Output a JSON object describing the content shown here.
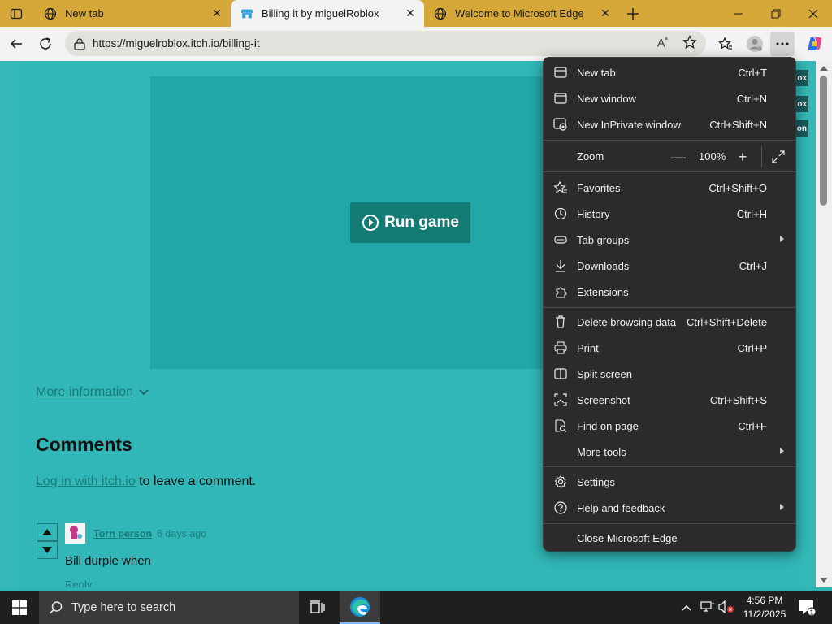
{
  "tabs": [
    {
      "label": "New tab",
      "icon": "globe-icon"
    },
    {
      "label": "Billing it by miguelRoblox",
      "icon": "itchio-icon",
      "active": true
    },
    {
      "label": "Welcome to Microsoft Edge",
      "icon": "globe-icon"
    }
  ],
  "address": {
    "url": "https://miguelroblox.itch.io/billing-it"
  },
  "page": {
    "run_label": "Run game",
    "more_info": "More information",
    "comments_heading": "Comments",
    "login_link": "Log in with itch.io",
    "login_rest": " to leave a comment.",
    "comment": {
      "author": "Torn person",
      "time": "6 days ago",
      "text": "Bill durple when",
      "reply": "Reply"
    },
    "side_pills": [
      "ox",
      "ox",
      "on"
    ]
  },
  "menu": {
    "items": [
      {
        "label": "New tab",
        "shortcut": "Ctrl+T",
        "icon": "new-tab-icon"
      },
      {
        "label": "New window",
        "shortcut": "Ctrl+N",
        "icon": "new-window-icon"
      },
      {
        "label": "New InPrivate window",
        "shortcut": "Ctrl+Shift+N",
        "icon": "inprivate-icon"
      }
    ],
    "zoom": {
      "label": "Zoom",
      "value": "100%"
    },
    "items2": [
      {
        "label": "Favorites",
        "shortcut": "Ctrl+Shift+O",
        "icon": "favorites-icon"
      },
      {
        "label": "History",
        "shortcut": "Ctrl+H",
        "icon": "history-icon"
      },
      {
        "label": "Tab groups",
        "shortcut": "",
        "icon": "tab-groups-icon",
        "submenu": true
      },
      {
        "label": "Downloads",
        "shortcut": "Ctrl+J",
        "icon": "download-icon"
      },
      {
        "label": "Extensions",
        "shortcut": "",
        "icon": "extensions-icon"
      }
    ],
    "items3": [
      {
        "label": "Delete browsing data",
        "shortcut": "Ctrl+Shift+Delete",
        "icon": "trash-icon"
      },
      {
        "label": "Print",
        "shortcut": "Ctrl+P",
        "icon": "print-icon"
      },
      {
        "label": "Split screen",
        "shortcut": "",
        "icon": "split-screen-icon"
      },
      {
        "label": "Screenshot",
        "shortcut": "Ctrl+Shift+S",
        "icon": "screenshot-icon"
      },
      {
        "label": "Find on page",
        "shortcut": "Ctrl+F",
        "icon": "find-icon"
      },
      {
        "label": "More tools",
        "shortcut": "",
        "icon": "",
        "submenu": true
      }
    ],
    "items4": [
      {
        "label": "Settings",
        "shortcut": "",
        "icon": "gear-icon"
      },
      {
        "label": "Help and feedback",
        "shortcut": "",
        "icon": "help-icon",
        "submenu": true
      }
    ],
    "close": {
      "label": "Close Microsoft Edge"
    }
  },
  "taskbar": {
    "search_placeholder": "Type here to search",
    "time": "4:56 PM",
    "date": "11/2/2025"
  },
  "colors": {
    "tabstrip": "#d6a83a",
    "page_bg": "#31b7b7",
    "game_frame": "#22a7a9",
    "run_button": "#137a74",
    "menu_bg": "#2b2b2b"
  }
}
